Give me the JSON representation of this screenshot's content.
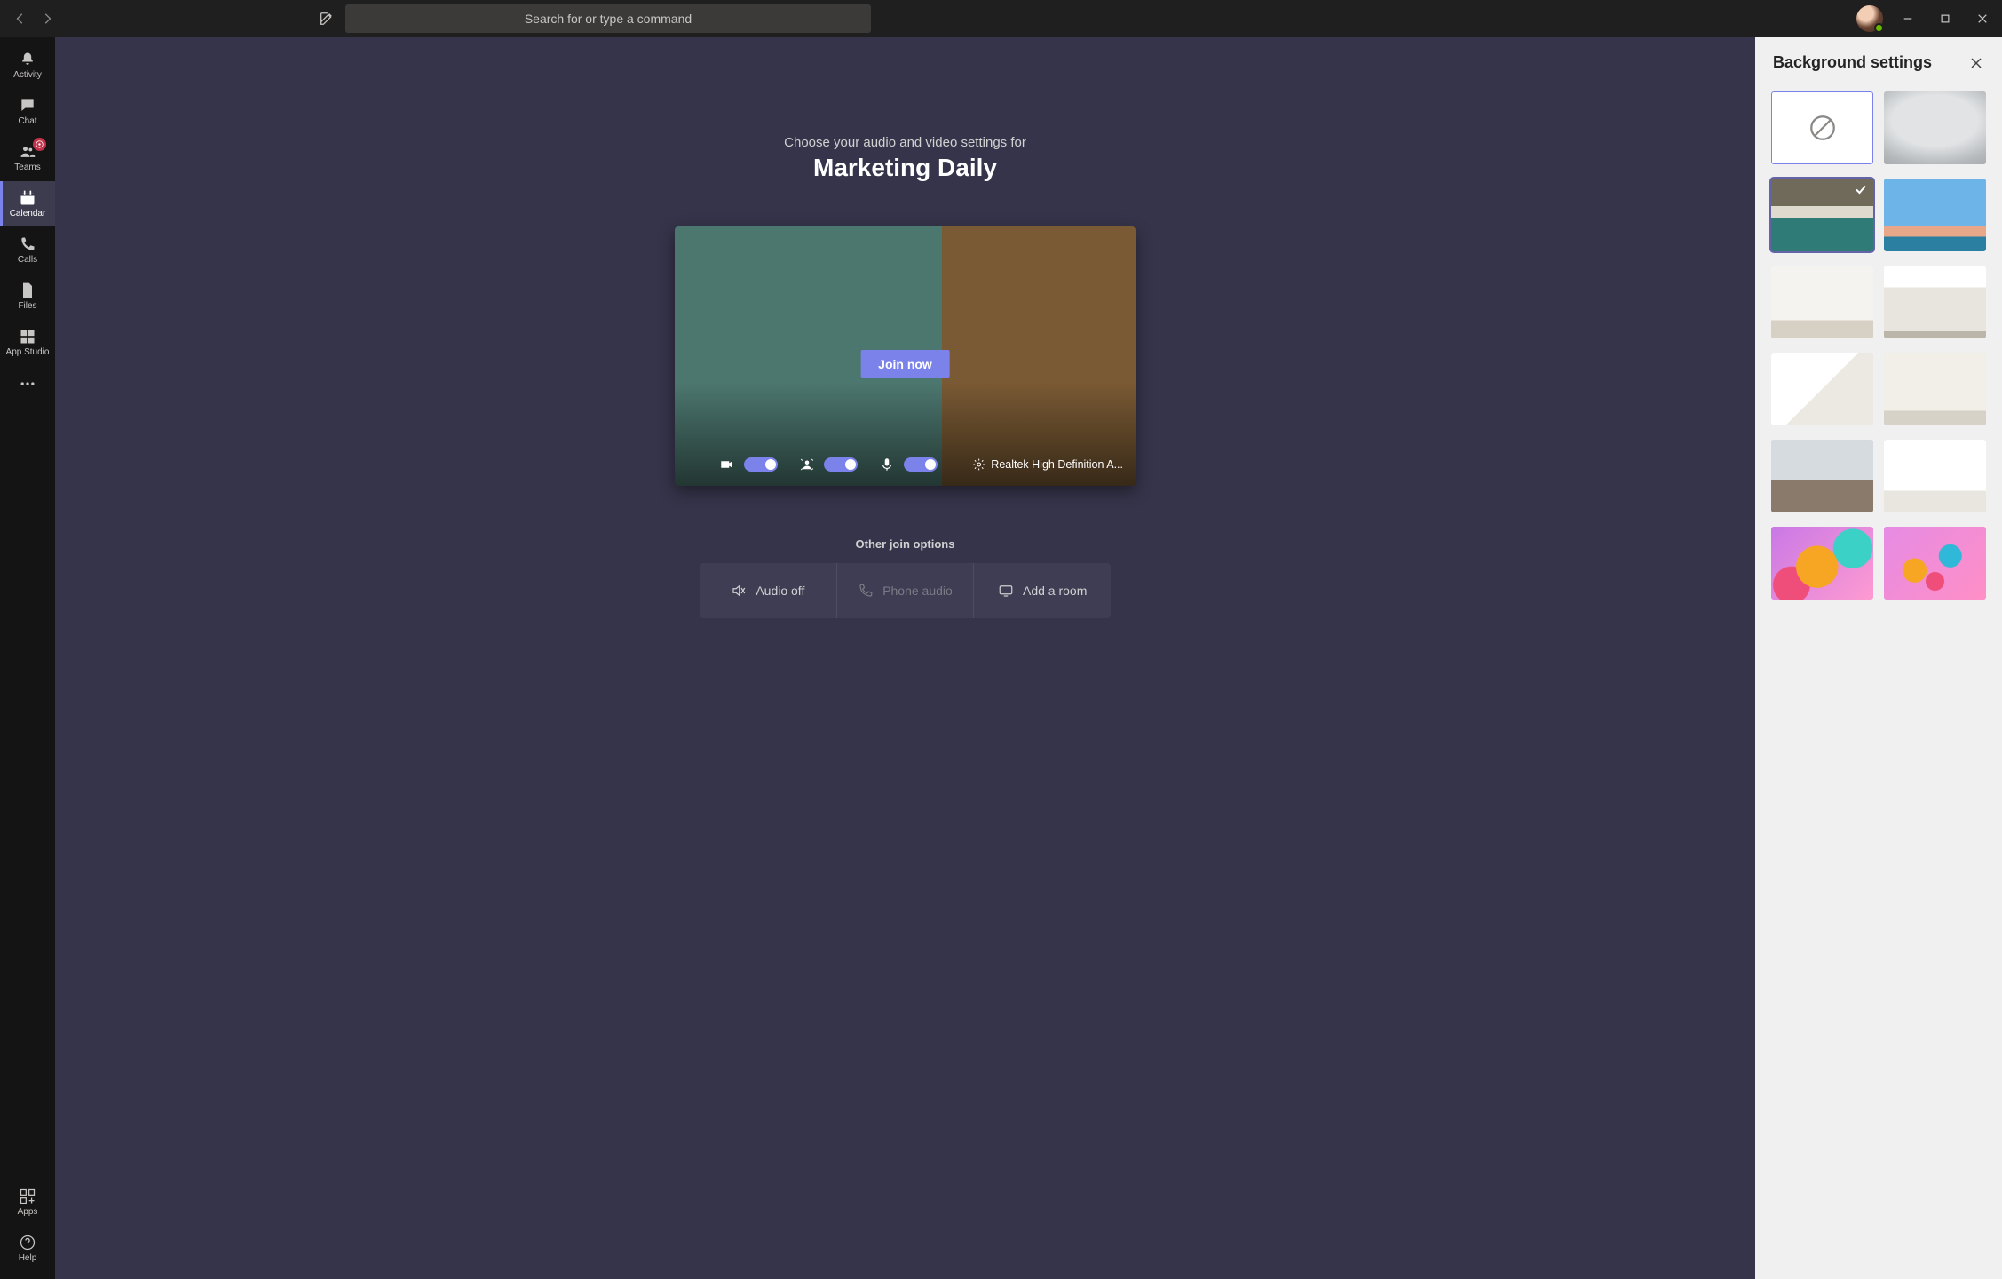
{
  "titlebar": {
    "search_placeholder": "Search for or type a command"
  },
  "rail": {
    "items": [
      {
        "id": "activity",
        "label": "Activity",
        "badge": false
      },
      {
        "id": "chat",
        "label": "Chat",
        "badge": false
      },
      {
        "id": "teams",
        "label": "Teams",
        "badge": true
      },
      {
        "id": "calendar",
        "label": "Calendar",
        "badge": false,
        "selected": true
      },
      {
        "id": "calls",
        "label": "Calls",
        "badge": false
      },
      {
        "id": "files",
        "label": "Files",
        "badge": false
      },
      {
        "id": "appstudio",
        "label": "App Studio",
        "badge": false
      }
    ],
    "bottom": [
      {
        "id": "apps",
        "label": "Apps"
      },
      {
        "id": "help",
        "label": "Help"
      }
    ]
  },
  "prejoin": {
    "heading": "Choose your audio and video settings for",
    "meeting_title": "Marketing Daily",
    "join_label": "Join now",
    "device_label": "Realtek High Definition A...",
    "toggles": {
      "camera": true,
      "background_fx": true,
      "mic": true
    },
    "other_heading": "Other join options",
    "options": {
      "audio_off": "Audio off",
      "phone_audio": "Phone audio",
      "add_room": "Add a room"
    }
  },
  "bg_panel": {
    "title": "Background settings",
    "tiles": [
      {
        "id": "none",
        "kind": "none"
      },
      {
        "id": "blur",
        "kind": "blur"
      },
      {
        "id": "lockers",
        "kind": "lockers",
        "selected": true
      },
      {
        "id": "sky",
        "kind": "sky"
      },
      {
        "id": "room1",
        "kind": "room1"
      },
      {
        "id": "room2",
        "kind": "room2"
      },
      {
        "id": "room3",
        "kind": "room3"
      },
      {
        "id": "room4",
        "kind": "room4"
      },
      {
        "id": "office",
        "kind": "office"
      },
      {
        "id": "room5",
        "kind": "room5"
      },
      {
        "id": "balloons1",
        "kind": "balloons1"
      },
      {
        "id": "balloons2",
        "kind": "balloons2"
      }
    ]
  },
  "colors": {
    "accent": "#7b83eb",
    "bg_stage": "#36344a",
    "bg_rail": "#151415",
    "bg_titlebar": "#201f1f",
    "panel_bg": "#f0f0f0"
  }
}
